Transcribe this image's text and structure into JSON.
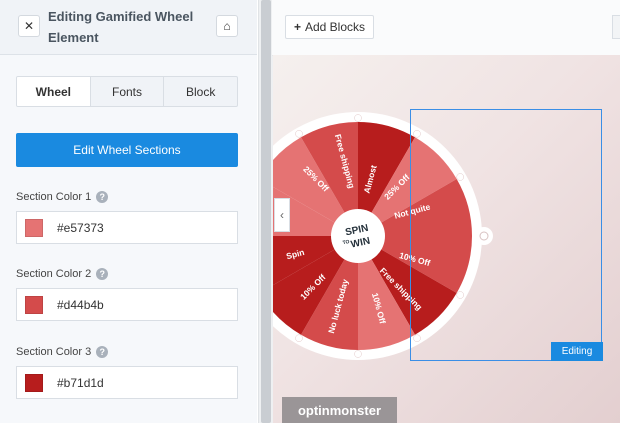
{
  "panel": {
    "title": "Editing Gamified Wheel Element",
    "close_icon": "✕",
    "home_icon": "⌂",
    "tabs": [
      "Wheel",
      "Fonts",
      "Block"
    ],
    "active_tab": "Wheel",
    "edit_button": "Edit Wheel Sections",
    "help_icon": "?",
    "colors": [
      {
        "label": "Section Color 1",
        "value": "#e57373"
      },
      {
        "label": "Section Color 2",
        "value": "#d44b4b"
      },
      {
        "label": "Section Color 3",
        "value": "#b71d1d"
      }
    ]
  },
  "toolbar": {
    "add_blocks_label": "Add Blocks"
  },
  "canvas": {
    "editing_tag": "Editing",
    "collapse_icon": "‹",
    "wheel": {
      "center_line1": "SPIN",
      "center_line2": "TO",
      "center_line3": "WIN",
      "segments": [
        "Almost",
        "25% Off",
        "Not quite",
        "10% Off",
        "Free shipping",
        "10% Off",
        "No luck today",
        "10% Off",
        "Spin",
        "",
        "25% Off",
        "Free shipping"
      ]
    },
    "brand": "optinmonster"
  }
}
